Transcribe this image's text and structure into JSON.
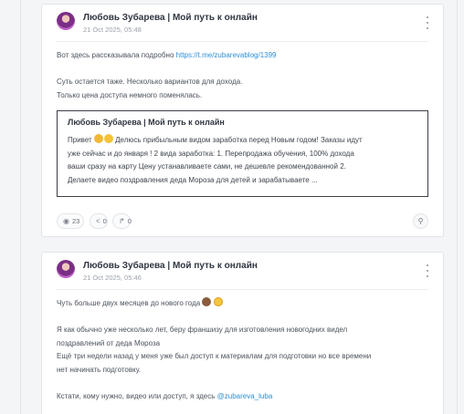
{
  "posts": [
    {
      "author": "Любовь Зубарева | Мой путь к онлайн",
      "date": "21 Oct 2025, 05:48",
      "line1_prefix": "Вот здесь рассказывала подробно ",
      "line1_link": "https://t.me/zubarevablog/1399",
      "line2": "Суть остается таже. Несколько вариантов для дохода.",
      "line3": "Только цена доступа немного поменялась.",
      "quote": {
        "author": "Любовь Зубарева | Мой путь к онлайн",
        "l1_a": "Привет ",
        "l1_b": " Делюсь прибыльным видом заработка перед Новым годом! Заказы идут",
        "l2": "уже сейчас и до января ! 2 вида заработка: 1. Перепродажа обучения, 100% дохода",
        "l3": "ваши сразу на карту Цену устанавливаете сами, не дешевле рекомендованной 2.",
        "l4": "Делаете видео поздравления деда Мороза для детей и зарабатываете ..."
      },
      "views": "23",
      "shares": "0",
      "forwards": "0",
      "icons": {
        "views": "eye-icon",
        "shares": "share-icon",
        "forwards": "forward-icon",
        "link": "link-icon",
        "menu": "more-vertical-icon"
      }
    },
    {
      "author": "Любовь Зубарева | Мой путь к онлайн",
      "date": "21 Oct 2025, 05:46",
      "line1": "Чуть больше двух месяцев до нового года",
      "line2": "Я как обычно уже несколько лет, беру франшизу для изготовления новогодних видел",
      "line3": "поздравлений от деда Мороза",
      "line4": "Ещё три недели назад у меня уже был доступ к материалам для подготовки но все времени",
      "line5": "нет начинать подготовку.",
      "line6_prefix": "Кстати, кому нужно, видео или доступ, я здесь ",
      "line6_link": "@zubareva_luba"
    }
  ]
}
